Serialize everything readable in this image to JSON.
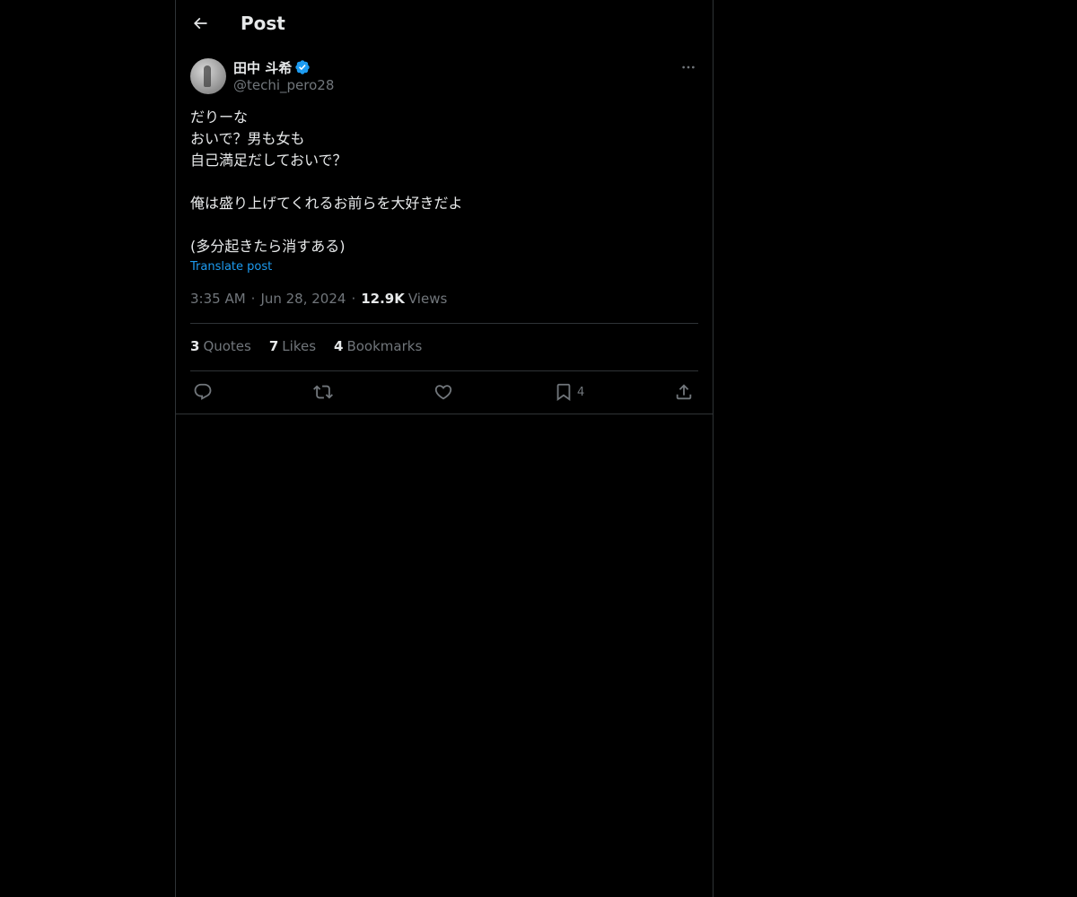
{
  "header": {
    "title": "Post"
  },
  "post": {
    "author": {
      "display_name": "田中 斗希",
      "handle": "@techi_pero28",
      "verified": true
    },
    "text": "だりーな\nおいで？男も女も\n自己満足だしておいで？\n\n俺は盛り上げてくれるお前らを大好きだよ\n\n(多分起きたら消すある)",
    "translate_label": "Translate post",
    "time": "3:35 AM",
    "date": "Jun 28, 2024",
    "views_count": "12.9K",
    "views_label": "Views",
    "separator": "·",
    "stats": {
      "quotes_count": "3",
      "quotes_label": "Quotes",
      "likes_count": "7",
      "likes_label": "Likes",
      "bookmarks_count": "4",
      "bookmarks_label": "Bookmarks"
    },
    "actions": {
      "reply_icon": "reply-icon",
      "repost_icon": "repost-icon",
      "like_icon": "heart-icon",
      "bookmark_icon": "bookmark-icon",
      "bookmark_count": "4",
      "share_icon": "share-icon"
    }
  },
  "colors": {
    "background": "#000000",
    "text": "#e7e9ea",
    "muted": "#71767b",
    "accent": "#1d9bf0",
    "border": "#2f3336"
  }
}
